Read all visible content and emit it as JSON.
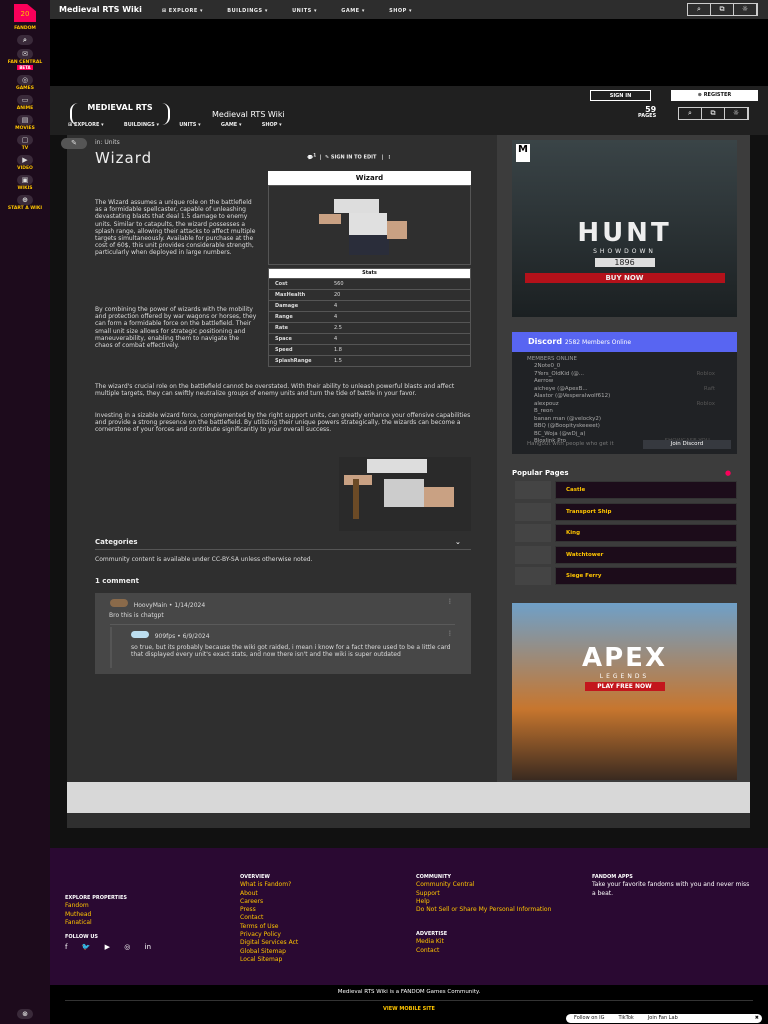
{
  "rail": {
    "count": "20",
    "items": [
      "FANDOM",
      "FAN CENTRAL",
      "GAMES",
      "ANIME",
      "MOVIES",
      "TV",
      "VIDEO",
      "WIKIS",
      "START A WIKI"
    ],
    "beta": "BETA"
  },
  "topbar": {
    "title": "Medieval RTS Wiki",
    "nav": [
      "EXPLORE",
      "BUILDINGS",
      "UNITS",
      "GAME",
      "SHOP"
    ]
  },
  "header": {
    "logo": "MEDIEVAL RTS",
    "name": "Medieval RTS Wiki",
    "sign_in": "SIGN IN",
    "register": "REGISTER",
    "pages_count": "59",
    "pages_label": "PAGES"
  },
  "article": {
    "breadcrumb": "in: Units",
    "title": "Wizard",
    "comment_count": "1",
    "edit": "SIGN IN TO EDIT",
    "paragraphs": [
      "The Wizard assumes a unique role on the battlefield as a formidable spellcaster, capable of unleashing devastating blasts that deal 1.5 damage to enemy units. Similar to catapults, the wizard possesses a splash range, allowing their attacks to affect multiple targets simultaneously. Available for purchase at the cost of 60$, this unit provides considerable strength, particularly when deployed in large numbers.",
      "By combining the power of wizards with the mobility and protection offered by war wagons or horses, they can form a formidable force on the battlefield. Their small unit size allows for strategic positioning and maneuverability, enabling them to navigate the chaos of combat effectively.",
      "The wizard's crucial role on the battlefield cannot be overstated. With their ability to unleash powerful blasts and affect multiple targets, they can swiftly neutralize groups of enemy units and turn the tide of battle in your favor.",
      "Investing in a sizable wizard force, complemented by the right support units, can greatly enhance your offensive capabilities and provide a strong presence on the battlefield. By utilizing their unique powers strategically, the wizards can become a cornerstone of your forces and contribute significantly to your overall success."
    ],
    "infobox": {
      "title": "Wizard",
      "stats_title": "Stats",
      "stats": [
        [
          "Cost",
          "560"
        ],
        [
          "MaxHealth",
          "20"
        ],
        [
          "Damage",
          "4"
        ],
        [
          "Range",
          "4"
        ],
        [
          "Rate",
          "2.5"
        ],
        [
          "Space",
          "4"
        ],
        [
          "Speed",
          "1.8"
        ],
        [
          "SplashRange",
          "1.5"
        ]
      ]
    },
    "categories": "Categories",
    "license": "Community content is available under CC-BY-SA unless otherwise noted.",
    "comments_title": "1 comment",
    "comments": [
      {
        "user": "HoovyMain",
        "date": "1/14/2024",
        "text": "Bro this is chatgpt"
      },
      {
        "user": "909fps",
        "date": "6/9/2024",
        "text": "so true, but its probably because the wiki got raided, i mean i know for a fact there used to be a little card that displayed every unit's exact stats, and now there isn't and the wiki is super outdated"
      }
    ]
  },
  "ads": {
    "hunt": "HUNT",
    "hunt_sub": "SHOWDOWN",
    "hunt_year": "1896",
    "hunt_cta": "BUY NOW",
    "apex": "APEX",
    "apex_sub": "LEGENDS",
    "apex_cta": "PLAY FREE NOW",
    "rating": "M"
  },
  "discord": {
    "name": "Discord",
    "online": "2582 Members Online",
    "members_label": "MEMBERS ONLINE",
    "members": [
      [
        "2Note0_0",
        ""
      ],
      [
        "7Yers_OldKid (@...",
        "Roblox"
      ],
      [
        "Aerrow",
        ""
      ],
      [
        "aicheye (@ApexB...",
        "Raft"
      ],
      [
        "Alastor (@Vesperalwolf612)",
        ""
      ],
      [
        "alexpouz",
        "Roblox"
      ],
      [
        "B_reon",
        ""
      ],
      [
        "banan man (@velocky2)",
        ""
      ],
      [
        "BBQ (@Boopityskeeeet)",
        ""
      ],
      [
        "BC_Woja (@wDj_a)",
        ""
      ],
      [
        "Bloxlink Pro",
        "SHOWCASE YOU..."
      ]
    ],
    "footer_text": "Hangout with people who get it",
    "join": "Join Discord"
  },
  "popular": {
    "title": "Popular Pages",
    "items": [
      "Castle",
      "Transport Ship",
      "King",
      "Watchtower",
      "Siege Ferry"
    ]
  },
  "footer": {
    "explore_title": "EXPLORE PROPERTIES",
    "explore": [
      "Fandom",
      "Muthead",
      "Fanatical"
    ],
    "follow": "FOLLOW US",
    "overview_title": "OVERVIEW",
    "overview": [
      "What is Fandom?",
      "About",
      "Careers",
      "Press",
      "Contact",
      "Terms of Use",
      "Privacy Policy",
      "Digital Services Act",
      "Global Sitemap",
      "Local Sitemap"
    ],
    "community_title": "COMMUNITY",
    "community": [
      "Community Central",
      "Support",
      "Help",
      "Do Not Sell or Share My Personal Information"
    ],
    "advertise_title": "ADVERTISE",
    "advertise": [
      "Media Kit",
      "Contact"
    ],
    "apps_title": "FANDOM APPS",
    "apps_text": "Take your favorite fandoms with you and never miss a beat.",
    "community_line": "Medieval RTS Wiki is a FANDOM Games Community.",
    "mobile": "VIEW MOBILE SITE",
    "pill": [
      "Follow on IG",
      "TikTok",
      "Join Fan Lab"
    ]
  }
}
